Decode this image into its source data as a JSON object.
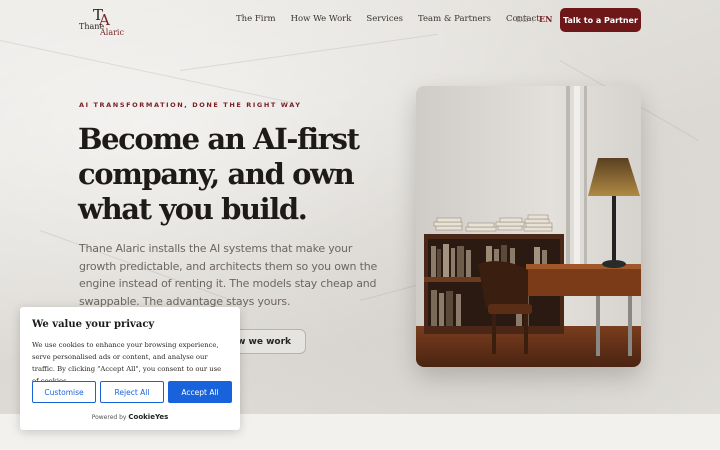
{
  "brand": {
    "monogram_t": "T",
    "monogram_a": "A",
    "name_first": "Thane",
    "name_last": "Alaric"
  },
  "nav": {
    "items": [
      "The Firm",
      "How We Work",
      "Services",
      "Team & Partners",
      "Contact"
    ],
    "lang_de": "DE",
    "lang_sep": "/",
    "lang_en": "EN",
    "active_lang": "EN",
    "cta": "Talk to a Partner"
  },
  "hero": {
    "eyebrow": "AI TRANSFORMATION, DONE THE RIGHT WAY",
    "title": "Become an AI-first company, and own what you build.",
    "lead": "Thane Alaric installs the AI systems that make your growth predictable, and architects them so you own the engine instead of renting it. The models stay cheap and swappable. The advantage stays yours.",
    "secondary_button": "How we work"
  },
  "cookie": {
    "title": "We value your privacy",
    "body": "We use cookies to enhance your browsing experience, serve personalised ads or content, and analyse our traffic. By clicking \"Accept All\", you consent to our use of cookies.",
    "customise": "Customise",
    "reject": "Reject All",
    "accept": "Accept All",
    "powered_by": "Powered by",
    "powered_brand": "CookieYes"
  },
  "colors": {
    "accent": "#6d1719",
    "cookie_blue": "#1863dc",
    "background": "#e9e7e3"
  }
}
